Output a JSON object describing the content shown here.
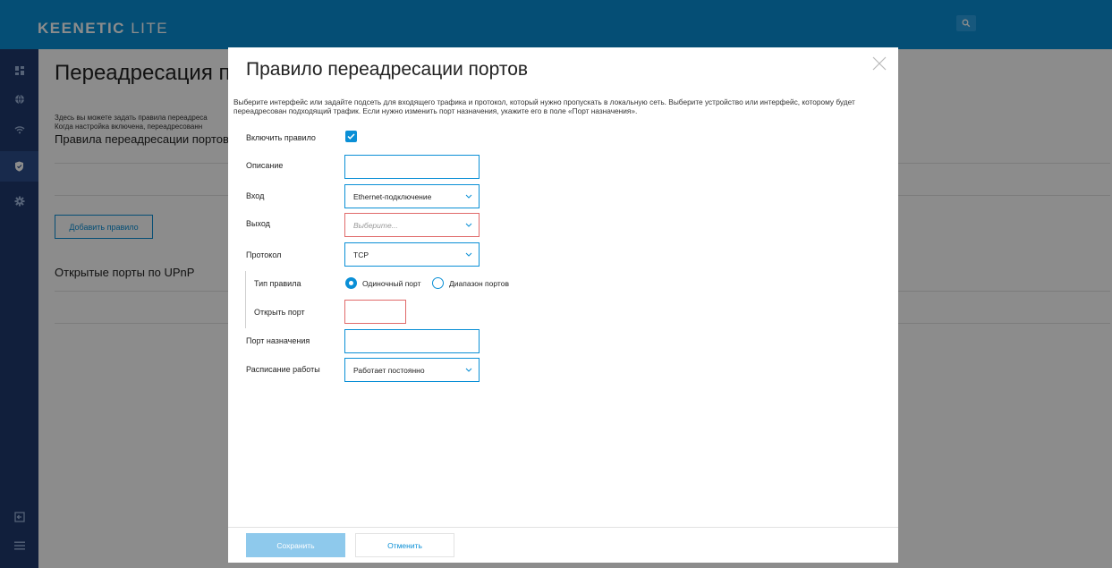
{
  "app": {
    "brand_bold": "KEENETIC",
    "brand_light": "LITE"
  },
  "colors": {
    "accent": "#0a8fd6",
    "sidebar": "#1f3a6e",
    "error_border": "#e06a6a"
  },
  "sidebar": {
    "icons": [
      "dashboard-icon",
      "globe-icon",
      "wifi-icon",
      "shield-icon",
      "gear-icon",
      "logout-icon",
      "menu-icon"
    ],
    "active": "shield-icon"
  },
  "background_page": {
    "title": "Переадресация по",
    "description_line1": "Здесь вы можете задать правила переадреса",
    "description_line2": "Когда настройка включена, переадресованн",
    "section_rules": "Правила переадресации портов",
    "add_rule_button": "Добавить правило",
    "section_upnp": "Открытые порты по UPnP"
  },
  "modal": {
    "title": "Правило переадресации портов",
    "description": "Выберите интерфейс или задайте подсеть для входящего трафика и протокол, который нужно пропускать в локальную сеть. Выберите устройство или интерфейс, которому будет переадресован подходящий трафик. Если нужно изменить порт назначения, укажите его в поле «Порт назначения».",
    "fields": {
      "enable_label": "Включить правило",
      "enable_checked": true,
      "description_label": "Описание",
      "description_value": "",
      "input_label": "Вход",
      "input_value": "Ethernet-подключение",
      "output_label": "Выход",
      "output_placeholder": "Выберите...",
      "protocol_label": "Протокол",
      "protocol_value": "TCP",
      "rule_type_label": "Тип правила",
      "rule_type_single": "Одиночный порт",
      "rule_type_range": "Диапазон портов",
      "rule_type_selected": "Одиночный порт",
      "open_port_label": "Открыть порт",
      "open_port_value": "",
      "dest_port_label": "Порт назначения",
      "dest_port_value": "",
      "schedule_label": "Расписание работы",
      "schedule_value": "Работает постоянно"
    },
    "save_button": "Сохранить",
    "cancel_button": "Отменить"
  }
}
